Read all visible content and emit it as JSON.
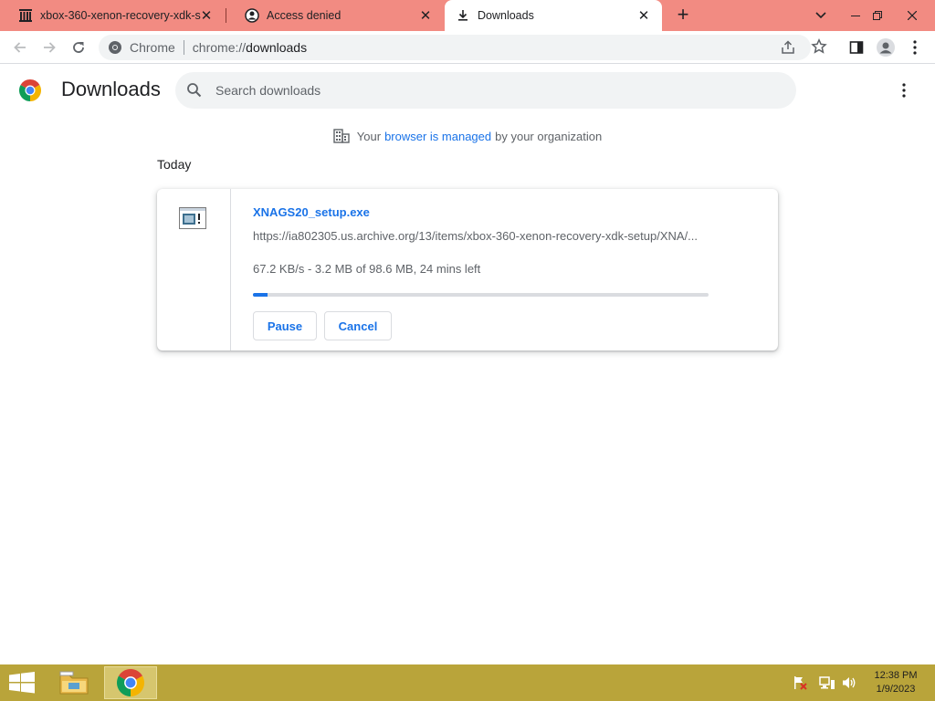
{
  "tabs": [
    {
      "title": "xbox-360-xenon-recovery-xdk-s",
      "favicon": "archive-org-icon",
      "active": false
    },
    {
      "title": "Access denied",
      "favicon": "access-denied-icon",
      "active": false
    },
    {
      "title": "Downloads",
      "favicon": "download-icon",
      "active": true
    }
  ],
  "omnibox": {
    "site_label": "Chrome",
    "url_scheme": "chrome://",
    "url_host": "downloads"
  },
  "page": {
    "title": "Downloads",
    "search_placeholder": "Search downloads",
    "managed_prefix": "Your",
    "managed_link": "browser is managed",
    "managed_suffix": "by your organization",
    "section": "Today"
  },
  "download": {
    "filename": "XNAGS20_setup.exe",
    "url": "https://ia802305.us.archive.org/13/items/xbox-360-xenon-recovery-xdk-setup/XNA/...",
    "status": "67.2 KB/s - 3.2 MB of 98.6 MB, 24 mins left",
    "progress_fraction": 0.032,
    "pause_label": "Pause",
    "cancel_label": "Cancel"
  },
  "taskbar": {
    "time": "12:38 PM",
    "date": "1/9/2023"
  },
  "colors": {
    "tabstrip": "#f28b82",
    "accent": "#1a73e8",
    "taskbar": "#b9a43a"
  }
}
